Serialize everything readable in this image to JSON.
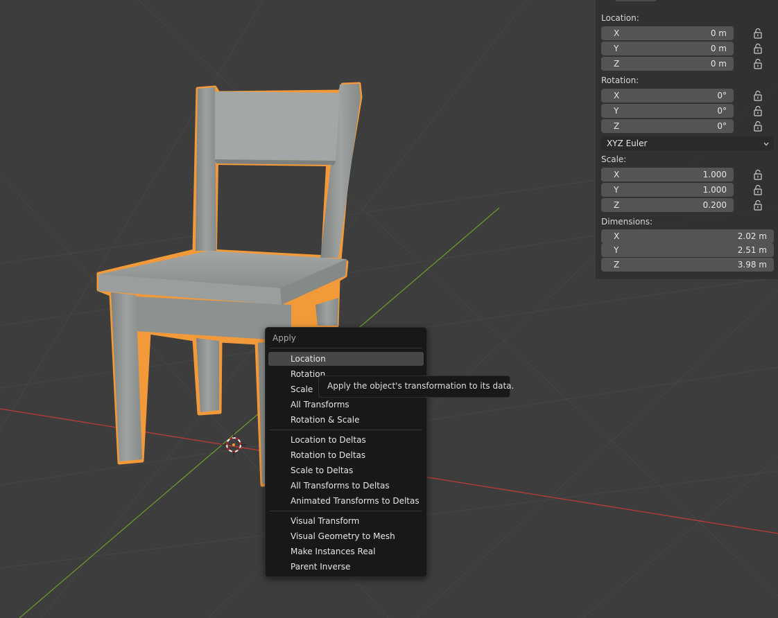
{
  "colors": {
    "viewport_bg": "#3d3d3d",
    "grid_line": "#464646",
    "x_axis": "#c03a3a",
    "y_axis": "#6a9a2a",
    "selection_outline": "#f29a3a",
    "field_bg": "#545454",
    "menu_bg": "#181818",
    "menu_highlight": "#474747"
  },
  "transform_panel": {
    "location_label": "Location:",
    "location": [
      {
        "axis": "X",
        "value": "0 m"
      },
      {
        "axis": "Y",
        "value": "0 m"
      },
      {
        "axis": "Z",
        "value": "0 m"
      }
    ],
    "rotation_label": "Rotation:",
    "rotation": [
      {
        "axis": "X",
        "value": "0°"
      },
      {
        "axis": "Y",
        "value": "0°"
      },
      {
        "axis": "Z",
        "value": "0°"
      }
    ],
    "rotation_mode": "XYZ Euler",
    "scale_label": "Scale:",
    "scale": [
      {
        "axis": "X",
        "value": "1.000"
      },
      {
        "axis": "Y",
        "value": "1.000"
      },
      {
        "axis": "Z",
        "value": "0.200"
      }
    ],
    "dimensions_label": "Dimensions:",
    "dimensions": [
      {
        "axis": "X",
        "value": "2.02 m"
      },
      {
        "axis": "Y",
        "value": "2.51 m"
      },
      {
        "axis": "Z",
        "value": "3.98 m"
      }
    ]
  },
  "apply_menu": {
    "title": "Apply",
    "groups": [
      [
        {
          "label": "Location",
          "highlighted": true
        },
        {
          "label": "Rotation",
          "highlighted": false
        },
        {
          "label": "Scale",
          "highlighted": false
        },
        {
          "label": "All Transforms",
          "highlighted": false
        },
        {
          "label": "Rotation & Scale",
          "highlighted": false
        }
      ],
      [
        {
          "label": "Location to Deltas",
          "highlighted": false
        },
        {
          "label": "Rotation to Deltas",
          "highlighted": false
        },
        {
          "label": "Scale to Deltas",
          "highlighted": false
        },
        {
          "label": "All Transforms to Deltas",
          "highlighted": false
        },
        {
          "label": "Animated Transforms to Deltas",
          "highlighted": false
        }
      ],
      [
        {
          "label": "Visual Transform",
          "highlighted": false
        },
        {
          "label": "Visual Geometry to Mesh",
          "highlighted": false
        },
        {
          "label": "Make Instances Real",
          "highlighted": false
        },
        {
          "label": "Parent Inverse",
          "highlighted": false
        }
      ]
    ]
  },
  "tooltip": {
    "text": "Apply the object's transformation to its data."
  }
}
